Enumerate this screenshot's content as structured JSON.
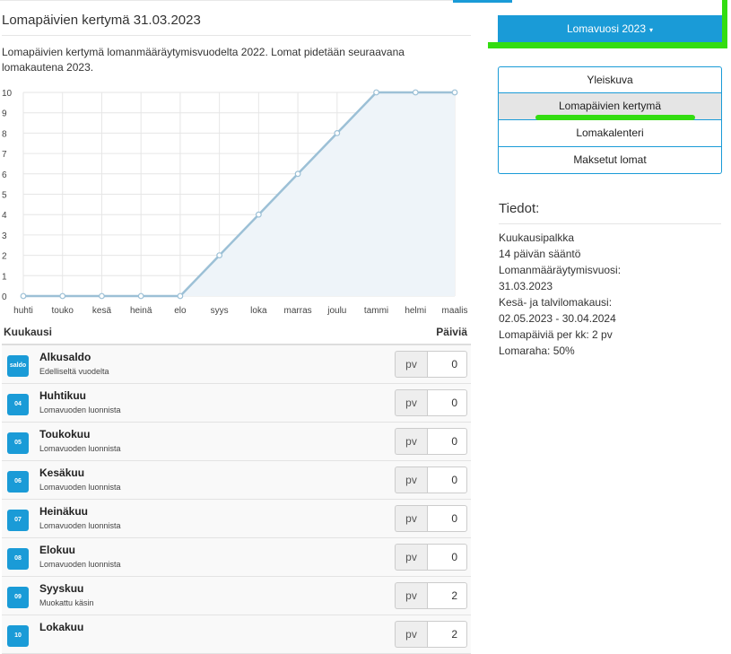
{
  "page": {
    "title": "Lomapäivien kertymä 31.03.2023",
    "description": "Lomapäivien kertymä lomanmääräytymisvuodelta 2022. Lomat pidetään seuraavana lomakautena 2023."
  },
  "year_dropdown": {
    "label": "Lomavuosi 2023",
    "caret": "▾"
  },
  "nav": [
    {
      "label": "Yleiskuva",
      "active": false
    },
    {
      "label": "Lomapäivien kertymä",
      "active": true
    },
    {
      "label": "Lomakalenteri",
      "active": false
    },
    {
      "label": "Maksetut lomat",
      "active": false
    }
  ],
  "info": {
    "title": "Tiedot:",
    "lines": [
      "Kuukausipalkka",
      "14 päivän sääntö",
      "Lomanmääräytymisvuosi:",
      "31.03.2023",
      "Kesä- ja talvilomakausi:",
      "02.05.2023 - 30.04.2024",
      "Lomapäiviä per kk: 2 pv",
      "Lomaraha: 50%"
    ]
  },
  "table": {
    "col_month": "Kuukausi",
    "col_days": "Päiviä",
    "rows": [
      {
        "badge": "saldo",
        "title": "Alkusaldo",
        "subtitle": "Edelliseltä vuodelta",
        "unit": "pv",
        "value": "0"
      },
      {
        "badge": "04",
        "title": "Huhtikuu",
        "subtitle": "Lomavuoden luonnista",
        "unit": "pv",
        "value": "0"
      },
      {
        "badge": "05",
        "title": "Toukokuu",
        "subtitle": "Lomavuoden luonnista",
        "unit": "pv",
        "value": "0"
      },
      {
        "badge": "06",
        "title": "Kesäkuu",
        "subtitle": "Lomavuoden luonnista",
        "unit": "pv",
        "value": "0"
      },
      {
        "badge": "07",
        "title": "Heinäkuu",
        "subtitle": "Lomavuoden luonnista",
        "unit": "pv",
        "value": "0"
      },
      {
        "badge": "08",
        "title": "Elokuu",
        "subtitle": "Lomavuoden luonnista",
        "unit": "pv",
        "value": "0"
      },
      {
        "badge": "09",
        "title": "Syyskuu",
        "subtitle": "Muokattu käsin",
        "unit": "pv",
        "value": "2"
      },
      {
        "badge": "10",
        "title": "Lokakuu",
        "subtitle": "",
        "unit": "pv",
        "value": "2"
      }
    ]
  },
  "chart_data": {
    "type": "area",
    "categories": [
      "huhti",
      "touko",
      "kesä",
      "heinä",
      "elo",
      "syys",
      "loka",
      "marras",
      "joulu",
      "tammi",
      "helmi",
      "maalis"
    ],
    "values": [
      0,
      0,
      0,
      0,
      0,
      2,
      4,
      6,
      8,
      10,
      10,
      10
    ],
    "ylim": [
      0,
      10
    ],
    "yticks": [
      0,
      1,
      2,
      3,
      4,
      5,
      6,
      7,
      8,
      9,
      10
    ],
    "grid": true,
    "line_color": "#9cc0d6",
    "fill_color": "#eef4f9"
  },
  "colors": {
    "accent": "#1a9bd7",
    "annotation": "#33dd11"
  }
}
